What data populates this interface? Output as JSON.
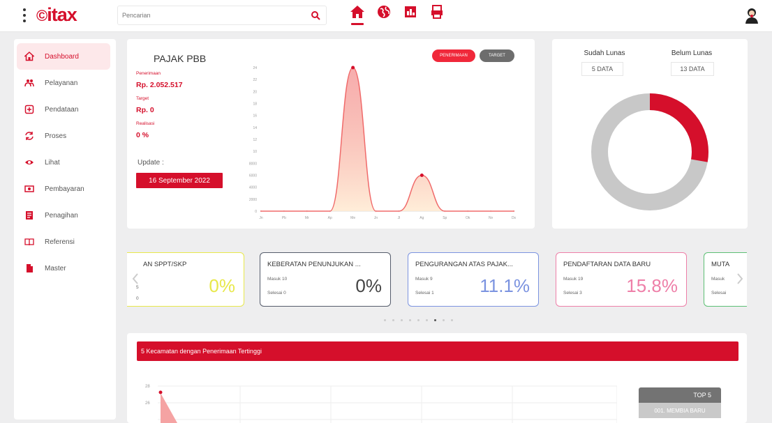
{
  "app": {
    "logo": "itax",
    "search_placeholder": "Pencarian",
    "nav_icons": [
      "home-icon",
      "globe-icon",
      "report-icon",
      "printer-icon"
    ],
    "accent": "#d50f2b"
  },
  "sidebar": {
    "items": [
      {
        "label": "Dashboard",
        "icon": "home-icon",
        "active": true
      },
      {
        "label": "Pelayanan",
        "icon": "users-icon"
      },
      {
        "label": "Pendataan",
        "icon": "plus-square-icon"
      },
      {
        "label": "Proses",
        "icon": "sync-icon"
      },
      {
        "label": "Lihat",
        "icon": "eye-icon"
      },
      {
        "label": "Pembayaran",
        "icon": "money-icon"
      },
      {
        "label": "Penagihan",
        "icon": "invoice-icon"
      },
      {
        "label": "Referensi",
        "icon": "book-icon"
      },
      {
        "label": "Master",
        "icon": "file-icon"
      }
    ]
  },
  "pbb": {
    "title": "PAJAK PBB",
    "penerimaan_label": "Penerimaan",
    "penerimaan_value": "Rp. 2.052.517",
    "target_label": "Target",
    "target_value": "Rp. 0",
    "realisasi_label": "Realisasi",
    "realisasi_value": "0 %",
    "update_label": "Update :",
    "update_date": "16 September 2022",
    "btn_penerimaan": "PENERIMAAN",
    "btn_target": "TARGET"
  },
  "chart_data": {
    "type": "line",
    "categories": [
      "Jn",
      "Pb",
      "Mr",
      "Ap",
      "Me",
      "Jn",
      "Jl",
      "Ag",
      "Sp",
      "Ok",
      "Nv",
      "Ds"
    ],
    "series": [
      {
        "values": [
          0,
          0,
          0,
          0,
          24,
          0,
          0,
          6,
          0,
          0,
          0,
          0
        ]
      }
    ],
    "ytick_labels": [
      "0",
      "2000",
      "4000",
      "6000",
      "8000",
      "10",
      "12",
      "14",
      "16",
      "18",
      "20",
      "22",
      "24"
    ],
    "ylim": [
      0,
      24
    ],
    "color": "#f06a6a"
  },
  "donut": {
    "sudah_label": "Sudah Lunas",
    "sudah_value": "5 DATA",
    "belum_label": "Belum Lunas",
    "belum_value": "13 DATA",
    "sudah_count": 5,
    "belum_count": 13,
    "sudah_color": "#d50f2b",
    "belum_color": "#c8c8c8"
  },
  "services": [
    {
      "title": "AN SPPT/SKP",
      "line1": "5",
      "line2": "0",
      "pct": "0%",
      "color": "#e8e84a"
    },
    {
      "title": "KEBERATAN PENUNJUKAN ...",
      "line1": "Masuk 10",
      "line2": "Selesai 0",
      "pct": "0%",
      "color": "#555c6b"
    },
    {
      "title": "PENGURANGAN ATAS PAJAK...",
      "line1": "Masuk 9",
      "line2": "Selesai 1",
      "pct": "11.1%",
      "color": "#7b93e0"
    },
    {
      "title": "PENDAFTARAN DATA BARU",
      "line1": "Masuk 19",
      "line2": "Selesai 3",
      "pct": "15.8%",
      "color": "#ee7fa8"
    },
    {
      "title": "MUTA",
      "line1": "Masuk",
      "line2": "Selesai",
      "pct": "",
      "color": "#5cbf74"
    }
  ],
  "kecamatan": {
    "header": "5 Kecamatan dengan Penerimaan Tertinggi",
    "ytick_labels": [
      "28",
      "26"
    ],
    "top5_header": "TOP 5",
    "top5_item": "001. MEMBIA BARU"
  }
}
